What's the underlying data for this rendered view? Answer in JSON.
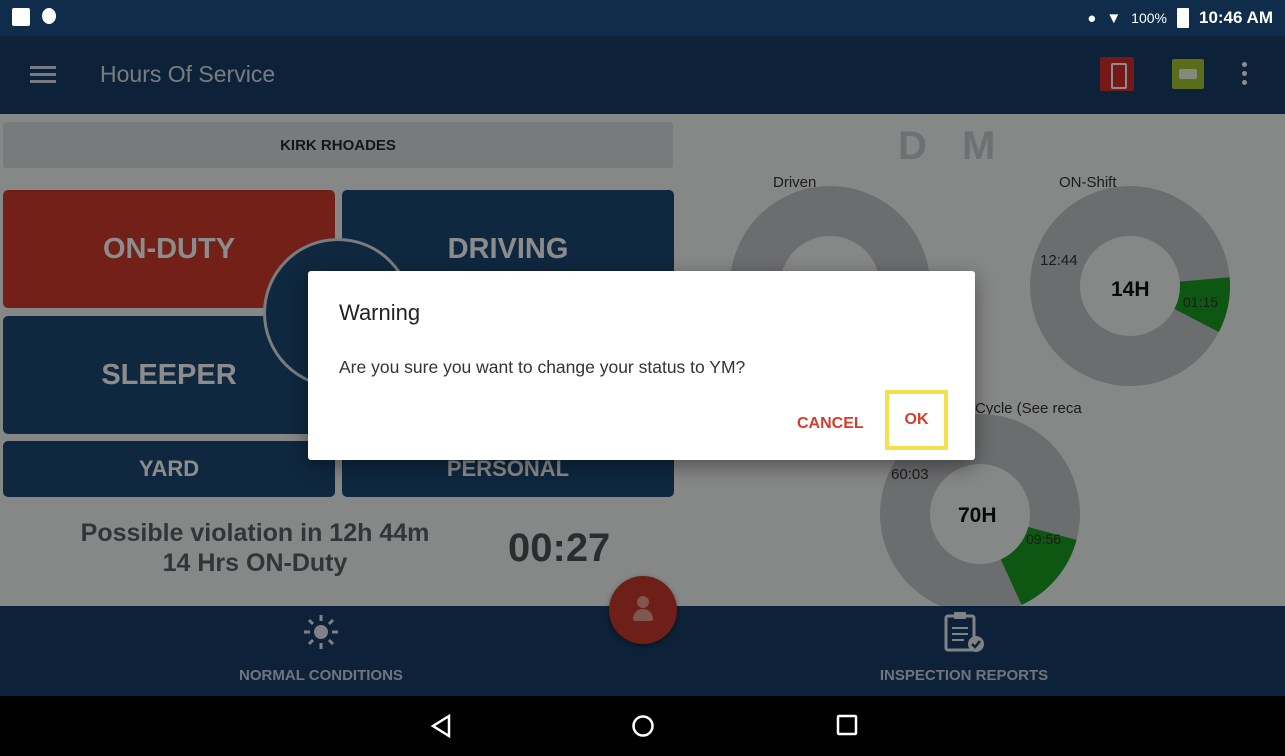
{
  "status_bar": {
    "battery": "100%",
    "time": "10:46 AM"
  },
  "app_bar": {
    "title": "Hours Of Service"
  },
  "driver": {
    "name": "KIRK RHOADES"
  },
  "status_tiles": {
    "on_duty": "ON-DUTY",
    "driving": "DRIVING",
    "sleeper": "SLEEPER",
    "yard": "YARD",
    "personal": "PERSONAL"
  },
  "violation": {
    "line1": "Possible violation in 12h 44m",
    "line2": "14 Hrs ON-Duty"
  },
  "timer": "00:27",
  "gauges": {
    "header_letters": "D M",
    "driven": {
      "label": "Driven"
    },
    "on_shift": {
      "label": "ON-Shift",
      "total": "14H",
      "remaining": "12:44",
      "used": "01:15",
      "used_fraction": 0.09
    },
    "cycle": {
      "label": "Cycle (See reca",
      "total": "70H",
      "remaining": "60:03",
      "used": "09:56",
      "used_fraction": 0.14
    }
  },
  "bottom_nav": {
    "conditions": "NORMAL CONDITIONS",
    "inspection": "INSPECTION REPORTS"
  },
  "dialog": {
    "title": "Warning",
    "message": "Are you sure you want to change your status to YM?",
    "cancel": "CANCEL",
    "ok": "OK"
  },
  "colors": {
    "header_blue": "#183f66",
    "tile_blue": "#1d4a74",
    "on_duty_red": "#d23b2c",
    "gauge_green": "#1a9e22",
    "dialog_accent": "#d43c2b",
    "highlight_yellow": "#f3e04a"
  }
}
